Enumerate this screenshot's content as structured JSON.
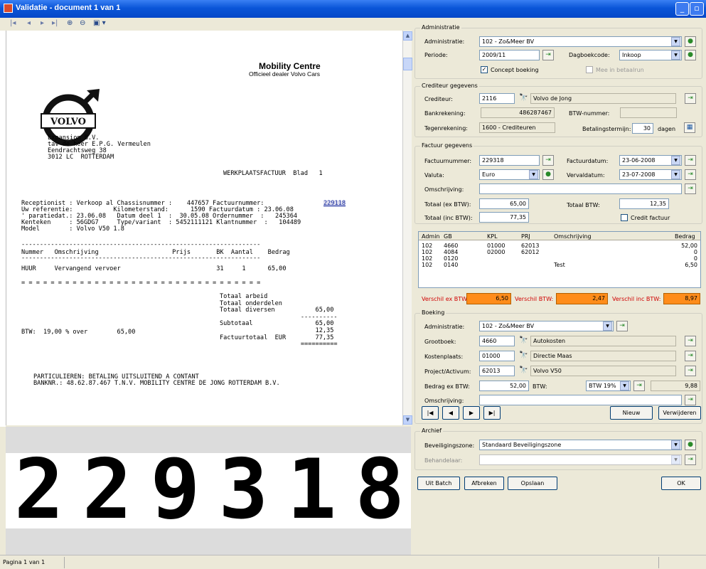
{
  "window": {
    "title": "Validatie - document 1 van 1",
    "min": "_",
    "restore": "▫",
    "close": "X"
  },
  "toolbar": {
    "first": "|◂",
    "prev": "◂",
    "next": "▸",
    "last": "▸|",
    "zoom_in": "⊕",
    "zoom_out": "⊖",
    "fit": "▣ ▾"
  },
  "doc": {
    "brand_title": "Mobility Centre",
    "brand_sub": "Officieel dealer Volvo Cars",
    "logo_text": "VOLVO",
    "address": "Expansion B.V.\ntav de heer E.P.G. Vermeulen\nEendrachtsweg 38\n3012 LC  ROTTERDAM",
    "heading": "WERKPLAATSFACTUUR  Blad   1",
    "info": "Receptionist : Verkoop al Chassisnummer :    447657 Factuurnummer:  \nUw referentie:           Kilometerstand:      1590 Factuurdatum : 23.06.08\n' paratiedat.: 23.06.08   Datum deel 1  :  30.05.08 Ordernummer  :   245364\nKenteken     : 56GDG7     Type/variant  : 5452111121 Klantnummer  :   104489\nModel        : Volvo V50 1.8",
    "invoice_highlight": "229118",
    "dash1": "-----------------------------------------------------------------",
    "cols": "Nummer   Omschrijving                    Prijs       BK  Aantal    Bedrag",
    "dash2": "-----------------------------------------------------------------",
    "line": "HUUR     Vervangend vervoer                          31     1      65,00",
    "eqline": "= = = = = = = = = = = = = = = = = = = = = = = = = = = = = = = = =",
    "totals": "Totaal arbeid\nTotaal onderdelen\nTotaal diversen           65,00\n                      ----------\nSubtotaal                 65,00\n                          12,35\nFactuurtotaal  EUR        77,35\n                      ==========",
    "btw": "BTW:  19,00 % over        65,00",
    "footer": "PARTICULIEREN: BETALING UITSLUITEND A CONTANT\nBANKNR.: 48.62.87.467 T.N.V. MOBILITY CENTRE DE JONG ROTTERDAM B.V."
  },
  "zoom": {
    "text": "229318"
  },
  "status": {
    "page": "Pagina 1 van 1"
  },
  "admin": {
    "group": "Administratie",
    "adm_label": "Administratie:",
    "adm_value": "102 - Zo&Meer BV",
    "periode_label": "Periode:",
    "periode_value": "2009/11",
    "dagboek_label": "Dagboekcode:",
    "dagboek_value": "Inkoop",
    "concept_label": "Concept boeking",
    "concept_check": "✓",
    "mee_label": "Mee in betaalrun"
  },
  "crediteur": {
    "group": "Crediteur gegevens",
    "cred_label": "Crediteur:",
    "cred_code": "2116",
    "cred_name": "Volvo de Jong",
    "bank_label": "Bankrekening:",
    "bank_value": "486287467",
    "btwnr_label": "BTW-nummer:",
    "btwnr_value": "",
    "tegen_label": "Tegenrekening:",
    "tegen_value": "1600 - Crediteuren",
    "termijn_label": "Betalingstermijn:",
    "termijn_value": "30",
    "dagen": "dagen"
  },
  "factuur": {
    "group": "Factuur gegevens",
    "nr_label": "Factuurnummer:",
    "nr_value": "229318",
    "datum_label": "Factuurdatum:",
    "datum_value": "23-06-2008",
    "valuta_label": "Valuta:",
    "valuta_value": "Euro",
    "verval_label": "Vervaldatum:",
    "verval_value": "23-07-2008",
    "omschr_label": "Omschrijving:",
    "omschr_value": "",
    "ex_label": "Totaal (ex BTW):",
    "ex_value": "65,00",
    "btw_label": "Totaal BTW:",
    "btw_value": "12,35",
    "inc_label": "Totaal (inc BTW):",
    "inc_value": "77,35",
    "credit_label": "Credit factuur"
  },
  "grid": {
    "headers": [
      "Admin",
      "GB",
      "KPL",
      "PRJ",
      "Omschrijving",
      "Bedrag"
    ],
    "rows": [
      [
        "102",
        "4660",
        "01000",
        "62013",
        "",
        "52,00"
      ],
      [
        "102",
        "4084",
        "02000",
        "62012",
        "",
        "0"
      ],
      [
        "102",
        "0120",
        "",
        "",
        "",
        "0"
      ],
      [
        "102",
        "0140",
        "",
        "",
        "Test",
        "6,50"
      ]
    ]
  },
  "verschil": {
    "ex_label": "Verschil ex BTW:",
    "ex_value": "6,50",
    "btw_label": "Verschil BTW:",
    "btw_value": "2,47",
    "inc_label": "Verschil inc BTW:",
    "inc_value": "8,97"
  },
  "boeking": {
    "group": "Boeking",
    "adm_label": "Administratie:",
    "adm_value": "102 - Zo&Meer BV",
    "gb_label": "Grootboek:",
    "gb_code": "4660",
    "gb_name": "Autokosten",
    "kpl_label": "Kostenplaats:",
    "kpl_code": "01000",
    "kpl_name": "Directie Maas",
    "prj_label": "Project/Activum:",
    "prj_code": "62013",
    "prj_name": "Volvo V50",
    "bedrag_label": "Bedrag ex BTW:",
    "bedrag_value": "52,00",
    "btw_label": "BTW:",
    "btw_value": "BTW 19%",
    "btw_amount": "9,88",
    "omschr_label": "Omschrijving:",
    "omschr_value": "",
    "nav_first": "|◀",
    "nav_prev": "◀",
    "nav_next": "▶",
    "nav_last": "▶|",
    "nieuw": "Nieuw",
    "verwijderen": "Verwijderen"
  },
  "archief": {
    "group": "Archief",
    "zone_label": "Beveiligingszone:",
    "zone_value": "Standaard Beveiligingszone",
    "behandel_label": "Behandelaar:",
    "behandel_value": ""
  },
  "buttons": {
    "uit_batch": "Uit Batch",
    "afbreken": "Afbreken",
    "opslaan": "Opslaan",
    "ok": "OK"
  },
  "colors": {
    "titlebar": "#0a55d8",
    "orange": "#ff8c1a",
    "verschil_text": "#d00000"
  }
}
